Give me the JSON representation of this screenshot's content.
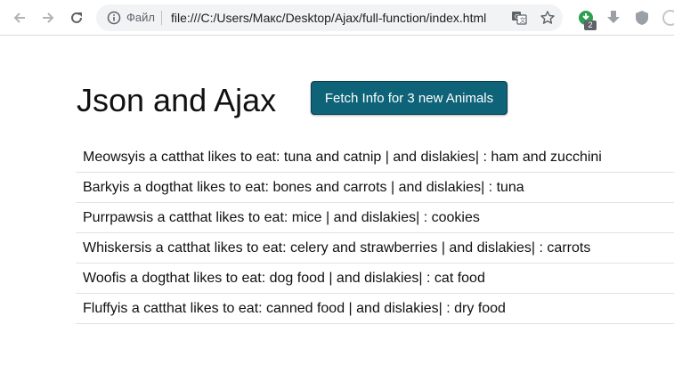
{
  "browser": {
    "file_label": "Файл",
    "url": "file:///C:/Users/Макс/Desktop/Ajax/full-function/index.html",
    "extension_badge": "2",
    "icons": [
      "back-arrow-icon",
      "forward-arrow-icon",
      "reload-icon",
      "info-icon",
      "translate-icon",
      "star-icon",
      "extension-icon",
      "download-icon",
      "shield-icon"
    ]
  },
  "page": {
    "title": "Json and Ajax",
    "fetch_button_label": "Fetch Info for 3 new Animals",
    "button_color": "#0e6378"
  },
  "animals": [
    "Meowsyis a catthat likes to eat: tuna and catnip | and dislakies| : ham and zucchini",
    "Barkyis a dogthat likes to eat: bones and carrots | and dislakies| : tuna",
    "Purrpawsis a catthat likes to eat: mice | and dislakies| : cookies",
    "Whiskersis a catthat likes to eat: celery and strawberries | and dislakies| : carrots",
    "Woofis a dogthat likes to eat: dog food | and dislakies| : cat food",
    "Fluffyis a catthat likes to eat: canned food | and dislakies| : dry food"
  ]
}
